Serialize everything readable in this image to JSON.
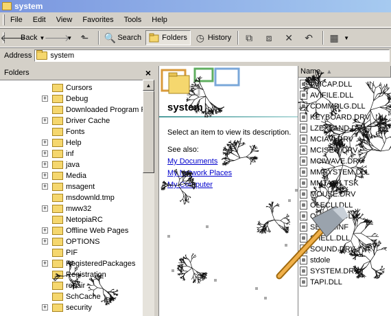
{
  "window": {
    "title": "system"
  },
  "menu": [
    "File",
    "Edit",
    "View",
    "Favorites",
    "Tools",
    "Help"
  ],
  "toolbar": {
    "back": "Back",
    "search": "Search",
    "folders": "Folders",
    "history": "History"
  },
  "address": {
    "label": "Address",
    "value": "system"
  },
  "folders_pane": {
    "title": "Folders",
    "items": [
      {
        "label": "Cursors",
        "expandable": false
      },
      {
        "label": "Debug",
        "expandable": true
      },
      {
        "label": "Downloaded Program F",
        "expandable": false
      },
      {
        "label": "Driver Cache",
        "expandable": true
      },
      {
        "label": "Fonts",
        "expandable": false
      },
      {
        "label": "Help",
        "expandable": true
      },
      {
        "label": "inf",
        "expandable": true
      },
      {
        "label": "java",
        "expandable": true
      },
      {
        "label": "Media",
        "expandable": true
      },
      {
        "label": "msagent",
        "expandable": true
      },
      {
        "label": "msdownld.tmp",
        "expandable": false
      },
      {
        "label": "mww32",
        "expandable": true
      },
      {
        "label": "NetopiaRC",
        "expandable": false
      },
      {
        "label": "Offline Web Pages",
        "expandable": true
      },
      {
        "label": "OPTIONS",
        "expandable": true
      },
      {
        "label": "PIF",
        "expandable": false
      },
      {
        "label": "RegisteredPackages",
        "expandable": true
      },
      {
        "label": "Registration",
        "expandable": false
      },
      {
        "label": "repair",
        "expandable": false
      },
      {
        "label": "SchCache",
        "expandable": false
      },
      {
        "label": "security",
        "expandable": true
      }
    ]
  },
  "webview": {
    "title": "system",
    "description": "Select an item to view its description.",
    "see_also": "See also:",
    "links": [
      "My Documents",
      "My Network Places",
      "My Computer"
    ]
  },
  "filelist": {
    "column": "Name",
    "files": [
      "AVICAP.DLL",
      "AVIFILE.DLL",
      "COMMDLG.DLL",
      "KEYBOARD.DRV",
      "LZEXPAND.DLL",
      "MCIAVI.DRV",
      "MCISEQ.DRV",
      "MCIWAVE.DRV",
      "MMSYSTEM.DLL",
      "MMTASK.TSK",
      "MOUSE.DRV",
      "OLECLI.DLL",
      "OLESVR.DLL",
      "SETUP.INF",
      "SHELL.DLL",
      "SOUND.DRV",
      "stdole",
      "SYSTEM.DRV",
      "TAPI.DLL"
    ]
  }
}
